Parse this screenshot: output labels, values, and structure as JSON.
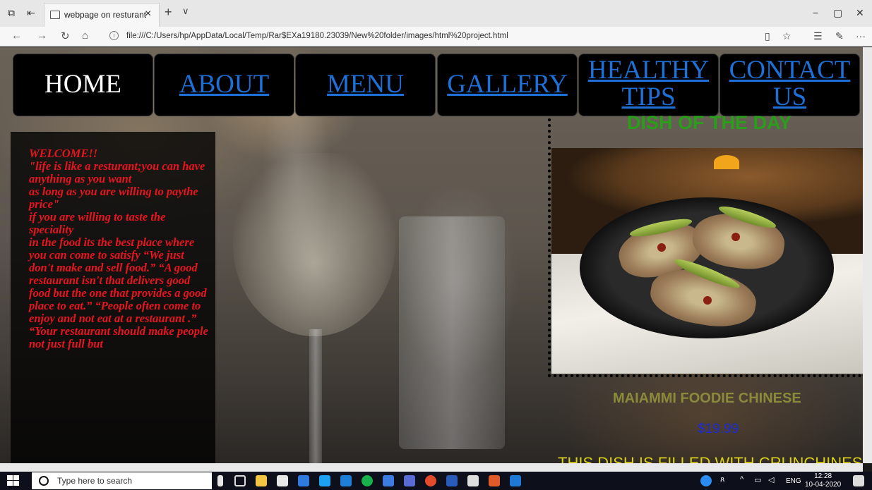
{
  "browser": {
    "tab_title": "webpage on resturant",
    "new_tab": "+",
    "tab_menu": "∨",
    "url": "file:///C:/Users/hp/AppData/Local/Temp/Rar$EXa19180.23039/New%20folder/images/html%20project.html",
    "win_min": "−",
    "win_max": "▢",
    "win_close": "✕",
    "back": "←",
    "forward": "→",
    "refresh": "↻",
    "home": "⌂",
    "more": "···"
  },
  "nav": {
    "home": "HOME",
    "about": "ABOUT",
    "menu": "MENU",
    "gallery": "GALLERY",
    "healthy_tips": "HEALTHY TIPS",
    "contact_us": "CONTACT US"
  },
  "welcome": {
    "text": "WELCOME!!\n\"life is like a resturant;you can have anything as you want\nas long as you are willing to paythe price\"\nif you are willing to taste the speciality\nin the food its the best place where\nyou can come to satisfy “We just don't make and sell food.” “A good restaurant isn't that delivers good food but the one that provides a good place to eat.” “People often come to enjoy and not eat at a restaurant .” “Your restaurant should make people not just full but"
  },
  "dish_of_the_day": {
    "title": "DISH OF THE DAY",
    "name": "MAIAMMI FOODIE CHINESE",
    "price": "$19.99",
    "description": "THIS DISH IS FILLED WITH CRUNCHINESS"
  },
  "taskbar": {
    "search_placeholder": "Type here to search",
    "lang": "ENG",
    "time": "12:28",
    "date": "10-04-2020"
  },
  "colors": {
    "nav_link": "#1e6fd6",
    "welcome_text": "#e8141e",
    "dotd_title": "#2a9d1a",
    "dish_name": "#8a8a3a",
    "price": "#1a2cd8",
    "desc": "#d8d01a"
  }
}
